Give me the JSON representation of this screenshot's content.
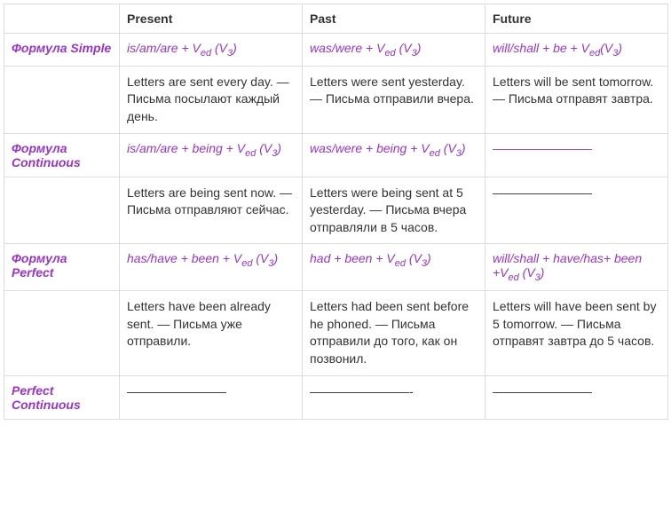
{
  "headers": {
    "blank": "",
    "present": "Present",
    "past": "Past",
    "future": "Future"
  },
  "rows": {
    "simple": {
      "label": "Формула Simple",
      "formula": {
        "present": "is/am/are + V<sub>ed</sub> (V<sub>3</sub>)",
        "past": "was/were + V<sub>ed</sub> (V<sub>3</sub>)",
        "future": "will/shall + be + V<sub>ed</sub>(V<sub>3</sub>)"
      },
      "example": {
        "present": " Letters are sent every day. — Письма посылают каждый день.",
        "past": " Letters were sent yesterday. — Письма отправили вчера.",
        "future": " Letters will be sent tomorrow. — Письма отправят завтра."
      }
    },
    "continuous": {
      "label": "Формула Continuous",
      "formula": {
        "present": "is/am/are + being + V<sub>ed</sub> (V<sub>3</sub>)",
        "past": "was/were + being + V<sub>ed</sub> (V<sub>3</sub>)",
        "future": "————————"
      },
      "example": {
        "present": " Letters are being sent now. — Письма отправляют сейчас.",
        "past": " Letters were being sent at 5 yesterday. — Письма вчера отправляли в 5 часов.",
        "future": "————————"
      }
    },
    "perfect": {
      "label": "Формула Perfect",
      "formula": {
        "present": "has/have + been + V<sub>ed</sub> (V<sub>3</sub>)",
        "past": "had + been + V<sub>ed</sub> (V<sub>3</sub>)",
        "future": " will/shall + have/has+ been +V<sub>ed</sub> (V<sub>3</sub>)"
      },
      "example": {
        "present": " Letters have been already sent. — Письма уже отправили.",
        "past": " Letters had been sent before he phoned. — Письма отправили до того, как он позвонил.",
        "future": " Letters will have been sent by 5 tomorrow. — Письма отправят завтра до 5 часов."
      }
    },
    "perfect_continuous": {
      "label": "Perfect Continuous",
      "formula": {
        "present": "————————",
        "past": "————————-",
        "future": "————————"
      }
    }
  },
  "chart_data": {
    "type": "table",
    "title": "Passive Voice Tense Formulas",
    "columns": [
      "Present",
      "Past",
      "Future"
    ],
    "rows": [
      {
        "aspect": "Simple",
        "present_formula": "is/am/are + Ved (V3)",
        "past_formula": "was/were + Ved (V3)",
        "future_formula": "will/shall + be + Ved(V3)",
        "present_example": "Letters are sent every day. — Письма посылают каждый день.",
        "past_example": "Letters were sent yesterday. — Письма отправили вчера.",
        "future_example": "Letters will be sent tomorrow. — Письма отправят завтра."
      },
      {
        "aspect": "Continuous",
        "present_formula": "is/am/are + being + Ved (V3)",
        "past_formula": "was/were + being + Ved (V3)",
        "future_formula": "—",
        "present_example": "Letters are being sent now. — Письма отправляют сейчас.",
        "past_example": "Letters were being sent at 5 yesterday. — Письма вчера отправляли в 5 часов.",
        "future_example": "—"
      },
      {
        "aspect": "Perfect",
        "present_formula": "has/have + been + Ved (V3)",
        "past_formula": "had + been + Ved (V3)",
        "future_formula": "will/shall + have/has + been + Ved (V3)",
        "present_example": "Letters have been already sent. — Письма уже отправили.",
        "past_example": "Letters had been sent before he phoned. — Письма отправили до того, как он позвонил.",
        "future_example": "Letters will have been sent by 5 tomorrow. — Письма отправят завтра до 5 часов."
      },
      {
        "aspect": "Perfect Continuous",
        "present_formula": "—",
        "past_formula": "—",
        "future_formula": "—"
      }
    ]
  }
}
